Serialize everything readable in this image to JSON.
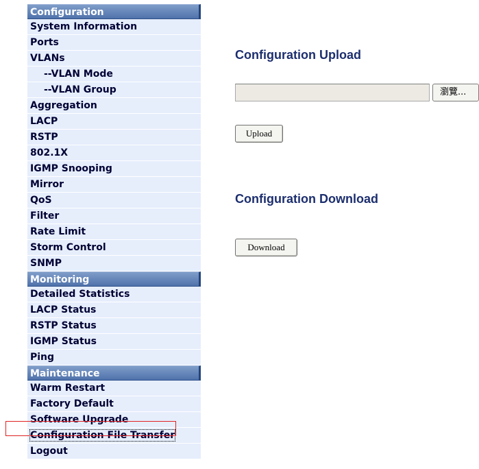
{
  "sidebar": {
    "sections": [
      {
        "header": "Configuration",
        "items": [
          "System Information",
          "Ports",
          "VLANs",
          "--VLAN Mode",
          "--VLAN Group",
          "Aggregation",
          "LACP",
          "RSTP",
          "802.1X",
          "IGMP Snooping",
          "Mirror",
          "QoS",
          "Filter",
          "Rate Limit",
          "Storm Control",
          "SNMP"
        ]
      },
      {
        "header": "Monitoring",
        "items": [
          "Detailed Statistics",
          "LACP Status",
          "RSTP Status",
          "IGMP Status",
          "Ping"
        ]
      },
      {
        "header": "Maintenance",
        "items": [
          "Warm Restart",
          "Factory Default",
          "Software Upgrade",
          "Configuration File Transfer",
          "Logout"
        ]
      }
    ]
  },
  "main": {
    "upload_title": "Configuration Upload",
    "file_value": "",
    "browse_label": "瀏覽...",
    "upload_button": "Upload",
    "download_title": "Configuration Download",
    "download_button": "Download"
  },
  "colors": {
    "header_bg": "#5a7cb3",
    "item_bg": "#e6eefc",
    "title_color": "#1c2e6e",
    "highlight": "#e02020"
  }
}
